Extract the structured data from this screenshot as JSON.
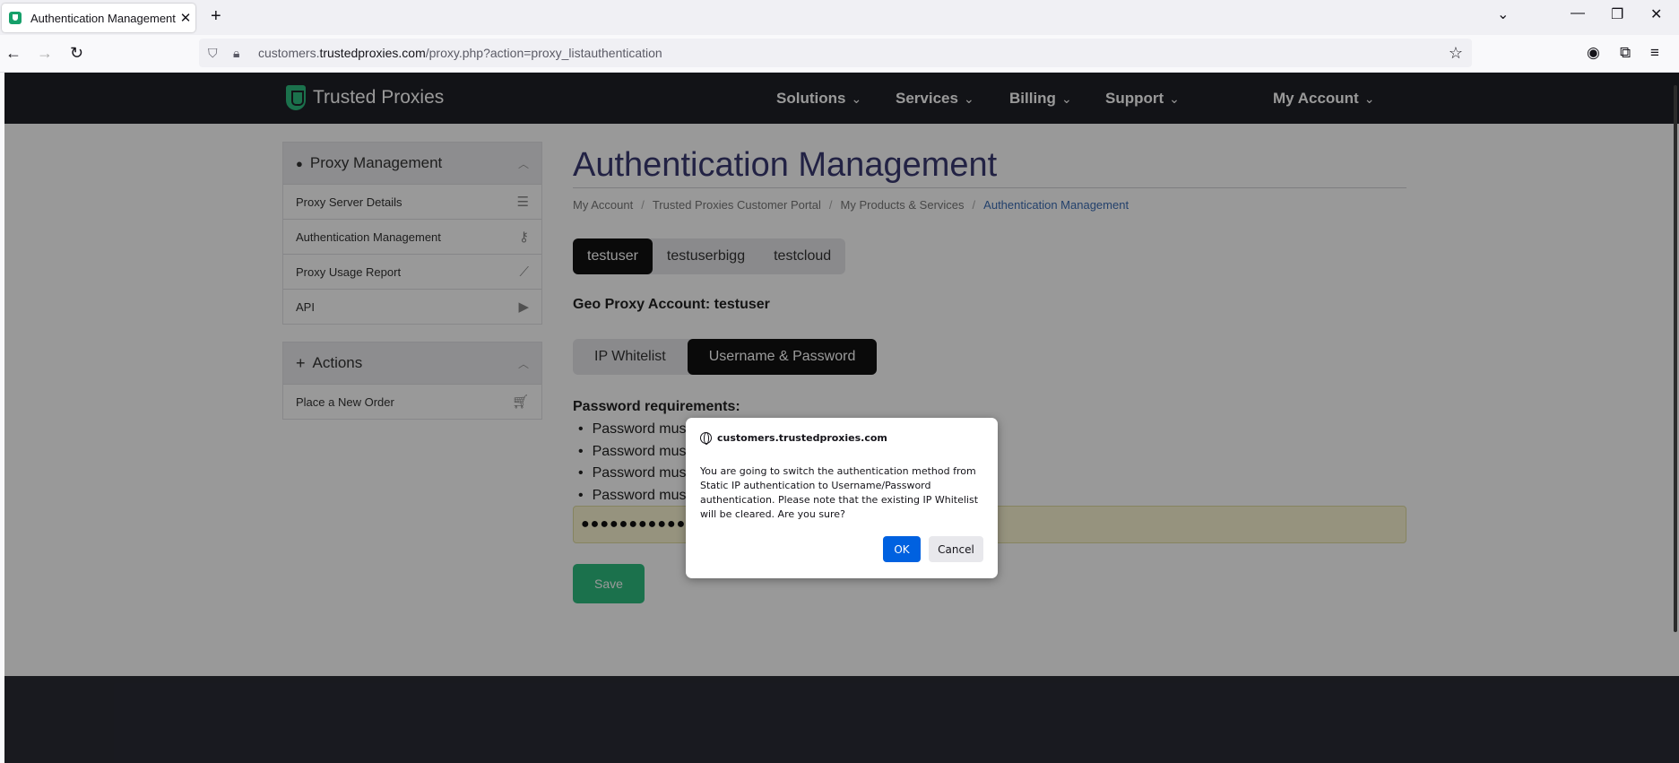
{
  "browser": {
    "tab_title": "Authentication Management - T",
    "tab_close": "✕",
    "new_tab": "+",
    "url_prefix": "customers.",
    "url_domain": "trustedproxies.com",
    "url_path": "/proxy.php?action=proxy_listauthentication"
  },
  "site": {
    "brand": "Trusted Proxies",
    "menu": [
      {
        "label": "Solutions"
      },
      {
        "label": "Services"
      },
      {
        "label": "Billing"
      },
      {
        "label": "Support"
      },
      {
        "label": "My Account"
      }
    ]
  },
  "sidebar": {
    "proxy_management": {
      "title": "Proxy Management",
      "items": [
        {
          "label": "Proxy Server Details",
          "icon": "list-icon"
        },
        {
          "label": "Authentication Management",
          "icon": "key-icon"
        },
        {
          "label": "Proxy Usage Report",
          "icon": "chart-icon"
        },
        {
          "label": "API",
          "icon": "play-icon"
        }
      ]
    },
    "actions": {
      "title": "Actions",
      "items": [
        {
          "label": "Place a New Order",
          "icon": "cart-icon"
        }
      ]
    }
  },
  "main": {
    "title": "Authentication Management",
    "breadcrumb": [
      "My Account",
      "Trusted Proxies Customer Portal",
      "My Products & Services",
      "Authentication Management"
    ],
    "accounts": [
      "testuser",
      "testuserbigg",
      "testcloud"
    ],
    "active_account": "testuser",
    "geo_label": "Geo Proxy Account: testuser",
    "auth_tabs": [
      "IP Whitelist",
      "Username & Password"
    ],
    "active_auth_tab": "Username & Password",
    "requirements_title": "Password requirements:",
    "requirements": [
      "Password must",
      "Password must",
      "Password must",
      "Password must"
    ],
    "password_value": "●●●●●●●●●●●●",
    "save_label": "Save"
  },
  "dialog": {
    "origin": "customers.trustedproxies.com",
    "message": "You are going to switch the authentication method from Static IP authentication to Username/Password authentication. Please note that the existing IP Whitelist will be cleared. Are you sure?",
    "ok_label": "OK",
    "cancel_label": "Cancel"
  },
  "colors": {
    "nav_bg": "#1f2027",
    "brand_green": "#2dbd7f",
    "title_color": "#3a3a72",
    "dialog_ok": "#0061e0"
  }
}
